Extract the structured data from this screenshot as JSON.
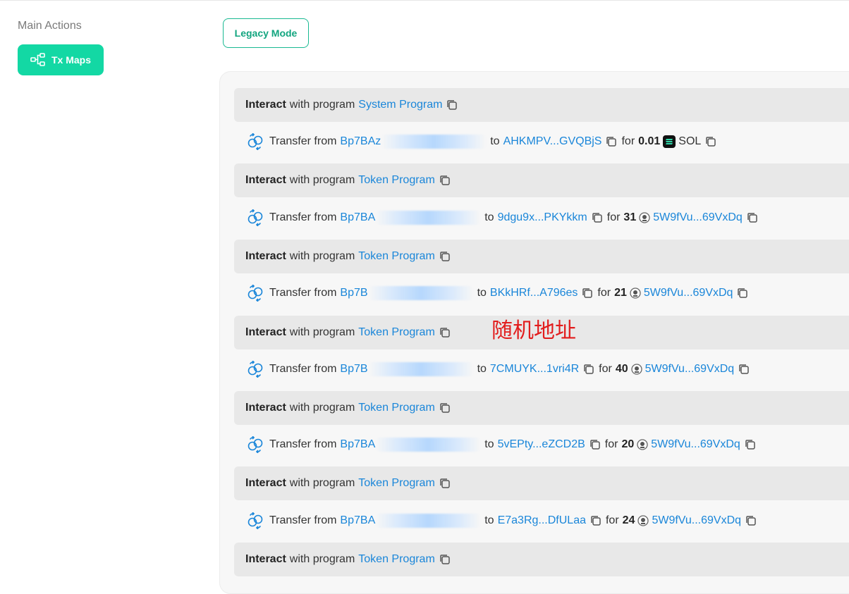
{
  "sidebar": {
    "section_title": "Main Actions",
    "tx_maps_label": "Tx Maps"
  },
  "toolbar": {
    "legacy_mode_label": "Legacy Mode"
  },
  "rows": {
    "interact_word": "Interact",
    "interact_with_text": "with program",
    "transfer_from_text": "Transfer from",
    "to_text": "to",
    "for_text": "for"
  },
  "instructions": [
    {
      "type": "interact",
      "program": "System Program"
    },
    {
      "type": "transfer",
      "from": "Bp7BAz",
      "to": "AHKMPV...GVQBjS",
      "amount": "0.01",
      "token": "SOL",
      "token_is_link": false
    },
    {
      "type": "interact",
      "program": "Token Program"
    },
    {
      "type": "transfer",
      "from": "Bp7BA",
      "to": "9dgu9x...PKYkkm",
      "amount": "31",
      "token": "5W9fVu...69VxDq",
      "token_is_link": true
    },
    {
      "type": "interact",
      "program": "Token Program"
    },
    {
      "type": "transfer",
      "from": "Bp7B",
      "to": "BKkHRf...A796es",
      "amount": "21",
      "token": "5W9fVu...69VxDq",
      "token_is_link": true
    },
    {
      "type": "interact",
      "program": "Token Program"
    },
    {
      "type": "transfer",
      "from": "Bp7B",
      "to": "7CMUYK...1vri4R",
      "amount": "40",
      "token": "5W9fVu...69VxDq",
      "token_is_link": true
    },
    {
      "type": "interact",
      "program": "Token Program"
    },
    {
      "type": "transfer",
      "from": "Bp7BA",
      "to": "5vEPty...eZCD2B",
      "amount": "20",
      "token": "5W9fVu...69VxDq",
      "token_is_link": true
    },
    {
      "type": "interact",
      "program": "Token Program"
    },
    {
      "type": "transfer",
      "from": "Bp7BA",
      "to": "E7a3Rg...DfULaa",
      "amount": "24",
      "token": "5W9fVu...69VxDq",
      "token_is_link": true
    },
    {
      "type": "interact",
      "program": "Token Program"
    }
  ],
  "annotation": "随机地址",
  "colors": {
    "accent": "#13d8a4",
    "link": "#1a86d9",
    "annotation": "#e21d1d"
  }
}
